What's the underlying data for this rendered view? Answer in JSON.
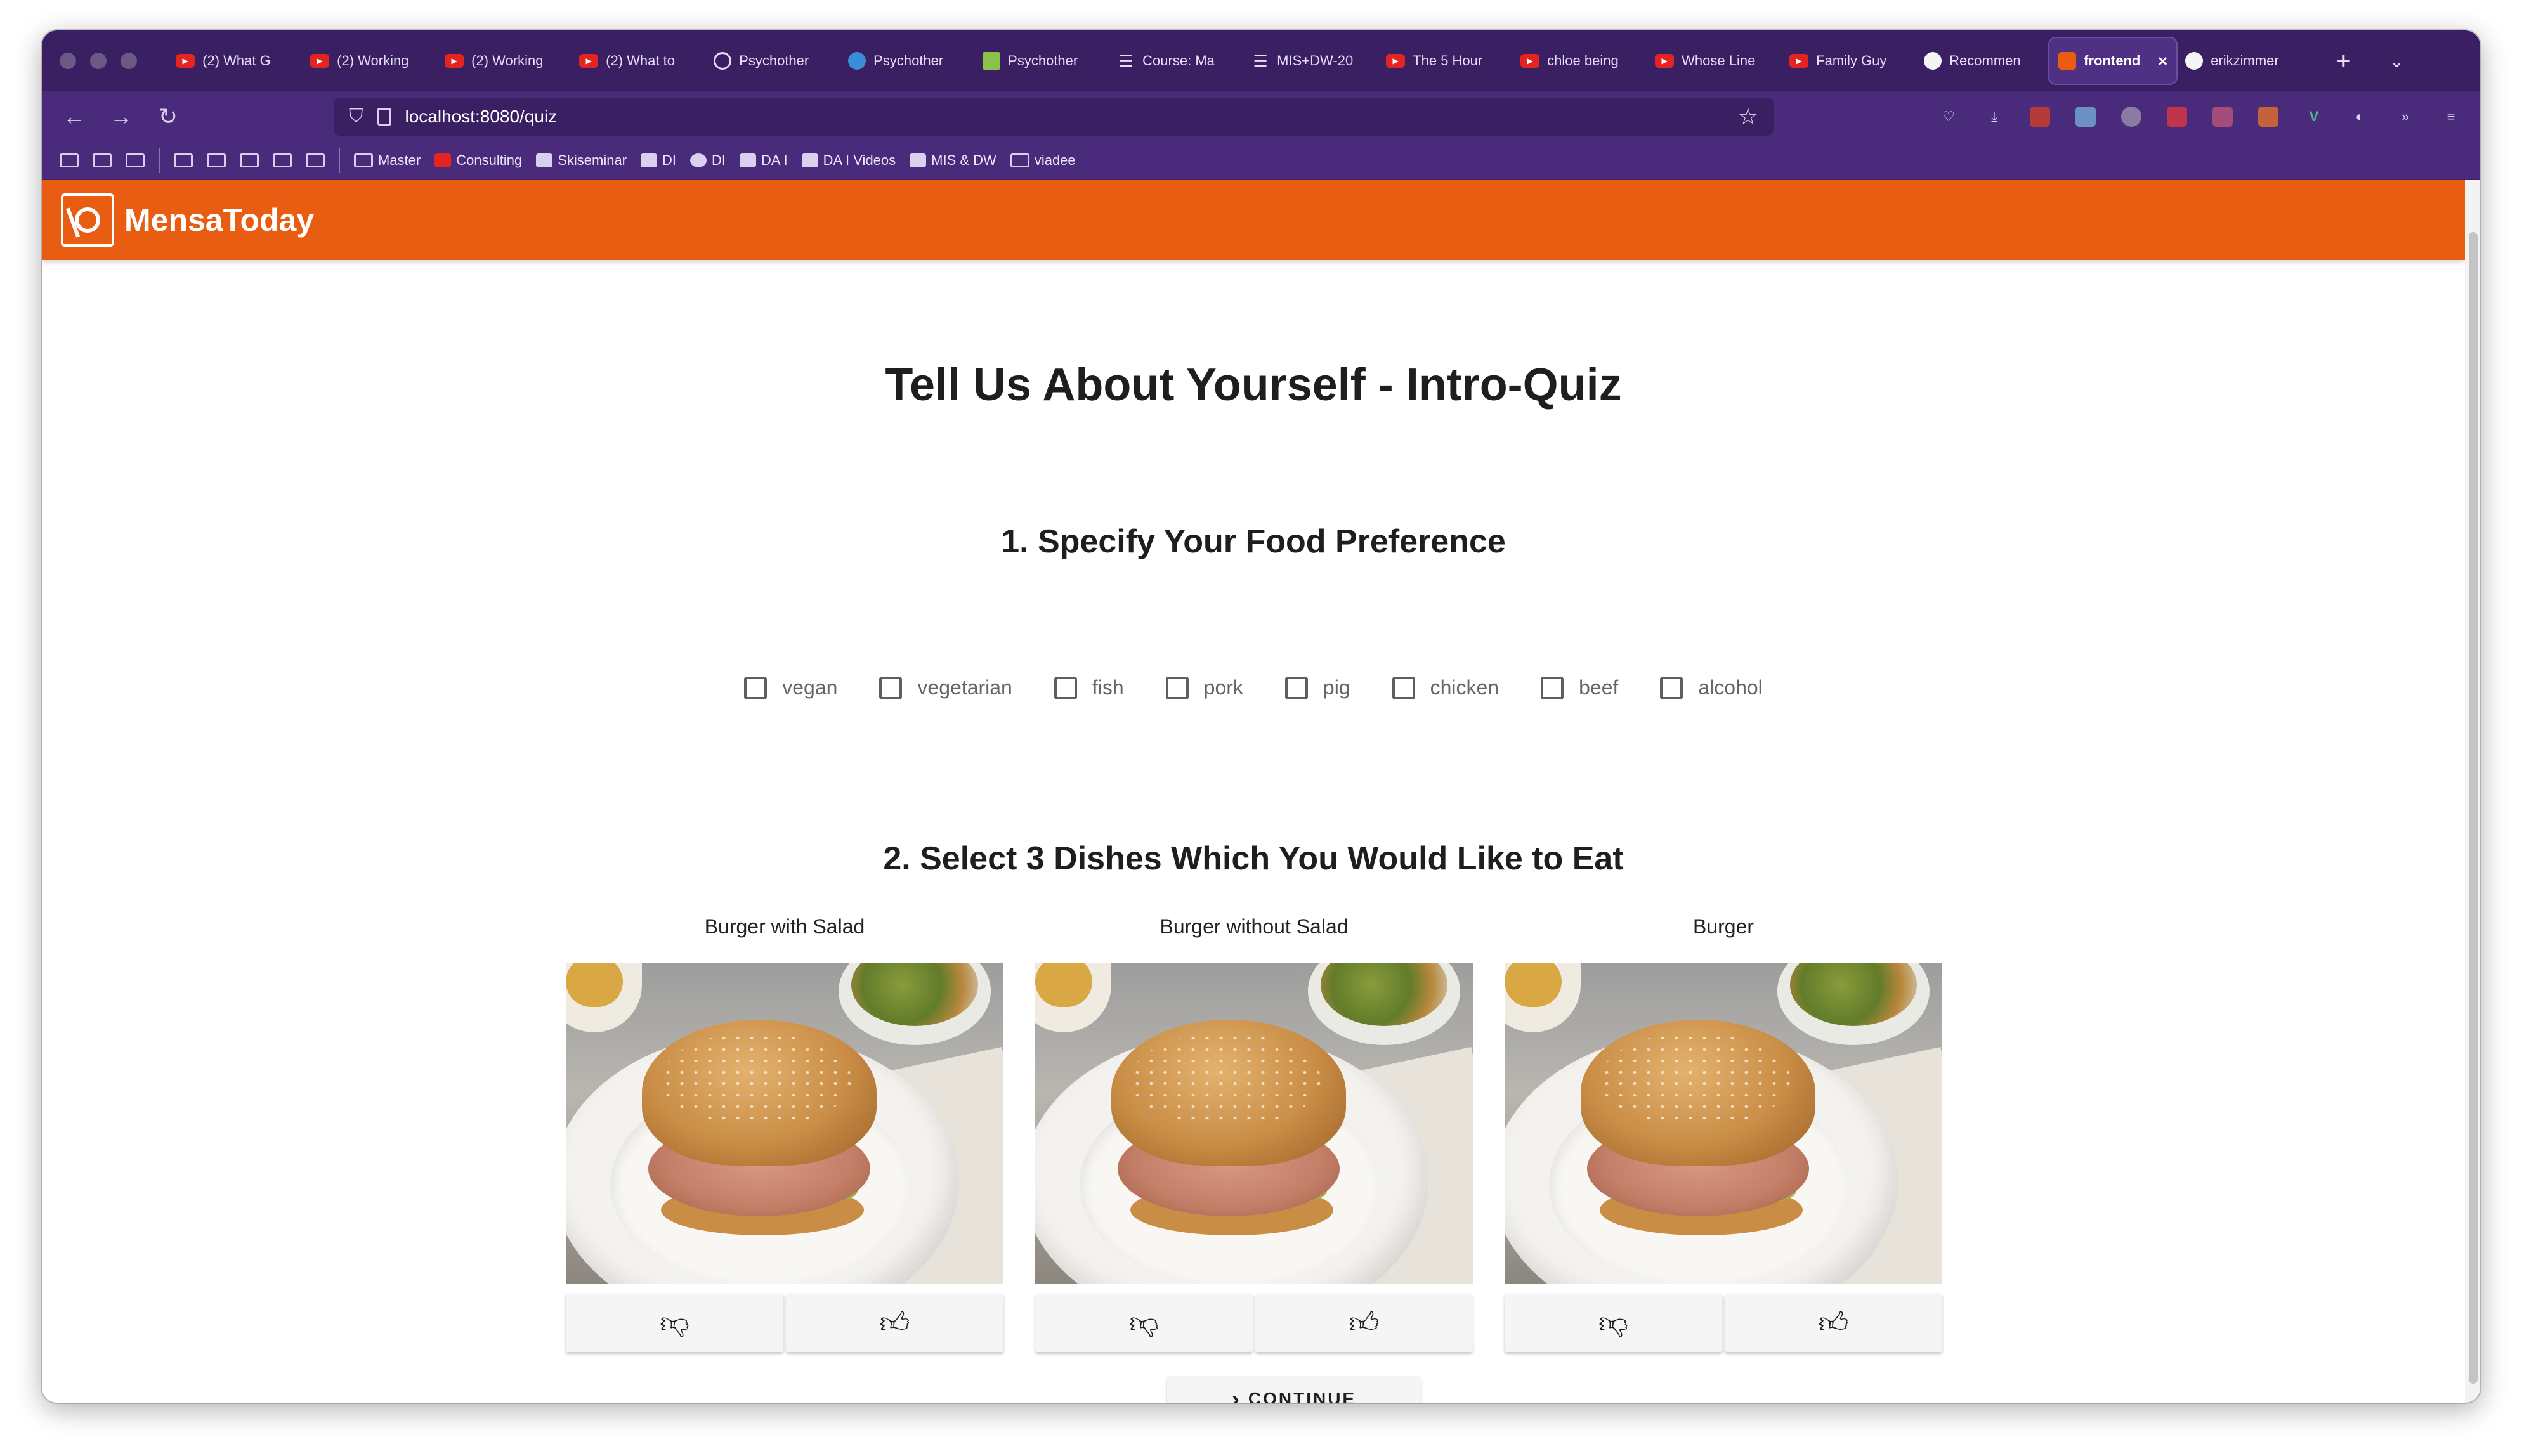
{
  "browser": {
    "tabs": [
      {
        "label": "(2) What G",
        "icon": "youtube-icon"
      },
      {
        "label": "(2) Working",
        "icon": "youtube-icon"
      },
      {
        "label": "(2) Working",
        "icon": "youtube-icon"
      },
      {
        "label": "(2) What to",
        "icon": "youtube-icon"
      },
      {
        "label": "Psychother",
        "icon": "globe-icon"
      },
      {
        "label": "Psychother",
        "icon": "edge-icon"
      },
      {
        "label": "Psychother",
        "icon": "leaf-icon"
      },
      {
        "label": "Course: Ma",
        "icon": "moodle-icon"
      },
      {
        "label": "MIS+DW-20",
        "icon": "moodle-icon"
      },
      {
        "label": "The 5 Hour",
        "icon": "youtube-icon"
      },
      {
        "label": "chloe being",
        "icon": "youtube-icon"
      },
      {
        "label": "Whose Line",
        "icon": "youtube-icon"
      },
      {
        "label": "Family Guy",
        "icon": "youtube-icon"
      },
      {
        "label": "Recommen",
        "icon": "github-icon"
      },
      {
        "label": "frontend",
        "icon": "mensa-icon",
        "active": true
      },
      {
        "label": "erikzimmer",
        "icon": "github-icon"
      }
    ],
    "url": "localhost:8080/quiz",
    "bookmarks": [
      "Master",
      "Consulting",
      "Skiseminar",
      "DI",
      "DI",
      "DA I",
      "DA I Videos",
      "MIS & DW",
      "viadee"
    ]
  },
  "app": {
    "title": "MensaToday",
    "brand_color": "#e85d12"
  },
  "quiz": {
    "heading": "Tell Us About Yourself - Intro-Quiz",
    "section1_title": "1. Specify Your Food Preference",
    "preferences": [
      "vegan",
      "vegetarian",
      "fish",
      "pork",
      "pig",
      "chicken",
      "beef",
      "alcohol"
    ],
    "section2_title": "2. Select 3 Dishes Which You Would Like to Eat",
    "dishes": [
      {
        "name": "Burger with Salad"
      },
      {
        "name": "Burger without Salad"
      },
      {
        "name": "Burger"
      }
    ],
    "continue_label": "CONTINUE"
  }
}
